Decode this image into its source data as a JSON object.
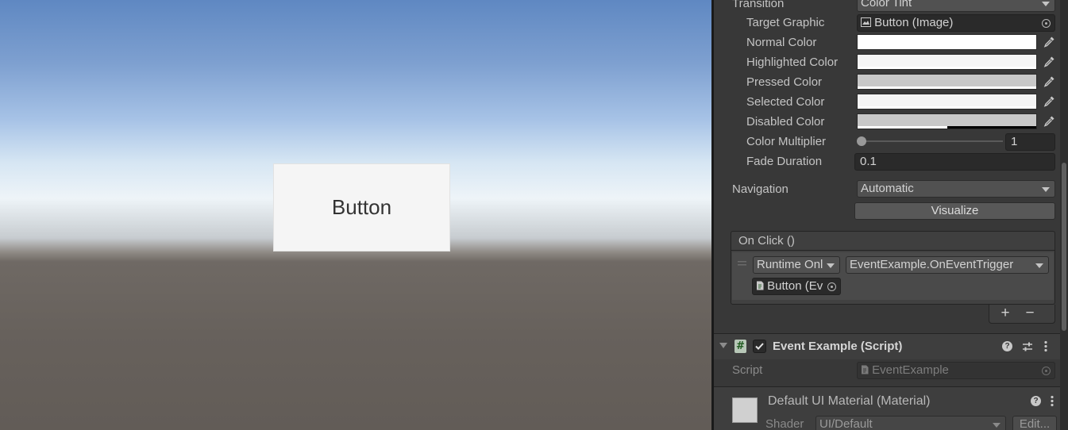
{
  "scene": {
    "button_label": "Button"
  },
  "inspector": {
    "transition": {
      "label": "Transition",
      "value": "Color Tint"
    },
    "target_graphic": {
      "label": "Target Graphic",
      "value": "Button (Image)",
      "icon": "image-icon"
    },
    "colors": [
      {
        "label": "Normal Color",
        "color": "#ffffff",
        "alpha": 1.0
      },
      {
        "label": "Highlighted Color",
        "color": "#f5f5f5",
        "alpha": 1.0
      },
      {
        "label": "Pressed Color",
        "color": "#c8c8c8",
        "alpha": 1.0
      },
      {
        "label": "Selected Color",
        "color": "#f5f5f5",
        "alpha": 1.0
      },
      {
        "label": "Disabled Color",
        "color": "#c8c8c8",
        "alpha": 0.5
      }
    ],
    "color_multiplier": {
      "label": "Color Multiplier",
      "value": "1",
      "slider_min": 1,
      "slider_max": 5,
      "slider_value": 1
    },
    "fade_duration": {
      "label": "Fade Duration",
      "value": "0.1"
    },
    "navigation": {
      "label": "Navigation",
      "value": "Automatic"
    },
    "visualize_label": "Visualize",
    "on_click": {
      "header": "On Click ()",
      "call_state": "Runtime Onl",
      "function": "EventExample.OnEventTrigger",
      "target": "Button (Ev",
      "add_label": "+",
      "remove_label": "−"
    },
    "event_component": {
      "title": "Event Example (Script)",
      "enabled": true,
      "script_label": "Script",
      "script_value": "EventExample"
    },
    "material": {
      "title": "Default UI Material (Material)",
      "shader_label": "Shader",
      "shader_value": "UI/Default",
      "edit_label": "Edit..."
    }
  }
}
